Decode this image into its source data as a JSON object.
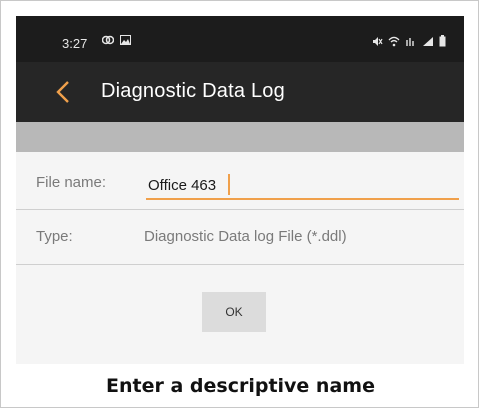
{
  "status_bar": {
    "time": "3:27",
    "left_icons": [
      "notification-icon",
      "image-icon"
    ],
    "right_icons": [
      "mute-icon",
      "wifi-icon",
      "signal-icon",
      "battery-icon"
    ]
  },
  "toolbar": {
    "title": "Diagnostic Data Log",
    "back_icon": "chevron-left-icon",
    "accent_color": "#f0a04b"
  },
  "form": {
    "file_name_label": "File name:",
    "file_name_value": "Office 463",
    "type_label": "Type:",
    "type_value": "Diagnostic Data log File (*.ddl)",
    "ok_label": "OK"
  },
  "caption": "Enter a descriptive name"
}
